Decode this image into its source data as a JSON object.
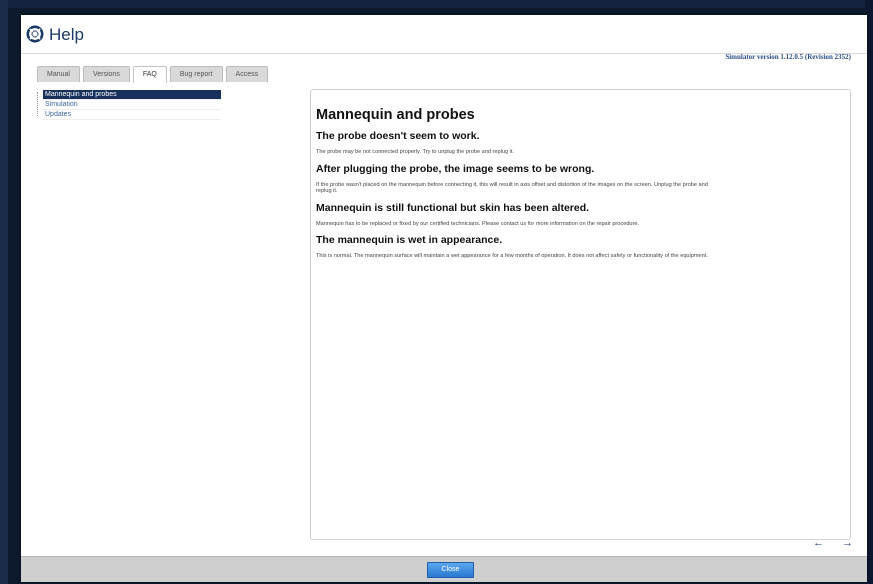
{
  "window": {
    "title": "Help",
    "version": "Simulator version 1.12.0.5 (Revision 2352)"
  },
  "tabs": [
    {
      "label": "Manual"
    },
    {
      "label": "Versions"
    },
    {
      "label": "FAQ"
    },
    {
      "label": "Bug report"
    },
    {
      "label": "Access"
    }
  ],
  "active_tab": "FAQ",
  "tree": {
    "items": [
      {
        "label": "Mannequin and probes"
      },
      {
        "label": "Simulation"
      },
      {
        "label": "Updates"
      }
    ],
    "selected": "Mannequin and probes"
  },
  "content": {
    "title": "Mannequin and probes",
    "sections": [
      {
        "heading": "The probe doesn't seem to work.",
        "text": "The probe may be not connected properly. Try to unplug the probe and replug it."
      },
      {
        "heading": "After plugging the probe, the image seems to be wrong.",
        "text": "If the probe wasn't placed on the mannequin before connecting it, this will result in axis offset and distortion of the images on the screen. Unplug the probe and replug it."
      },
      {
        "heading": "Mannequin is still functional but skin has been altered.",
        "text": "Mannequin has to be replaced or fixed by our certified technicians. Please contact us for more information on the repair procedure."
      },
      {
        "heading": "The mannequin is wet in appearance.",
        "text": "This is normal. The mannequin surface will maintain a wet appearance for a few months of operation. It does not affect safety or functionality of the equipment."
      }
    ]
  },
  "nav": {
    "back_icon": "arrow-left-icon",
    "back": "←",
    "forward_icon": "arrow-right-icon",
    "forward": "→"
  },
  "footer": {
    "close_label": "Close"
  },
  "icons": {
    "help": "lifebuoy-icon"
  },
  "colors": {
    "accent": "#17315c",
    "button": "#3a8de0"
  }
}
